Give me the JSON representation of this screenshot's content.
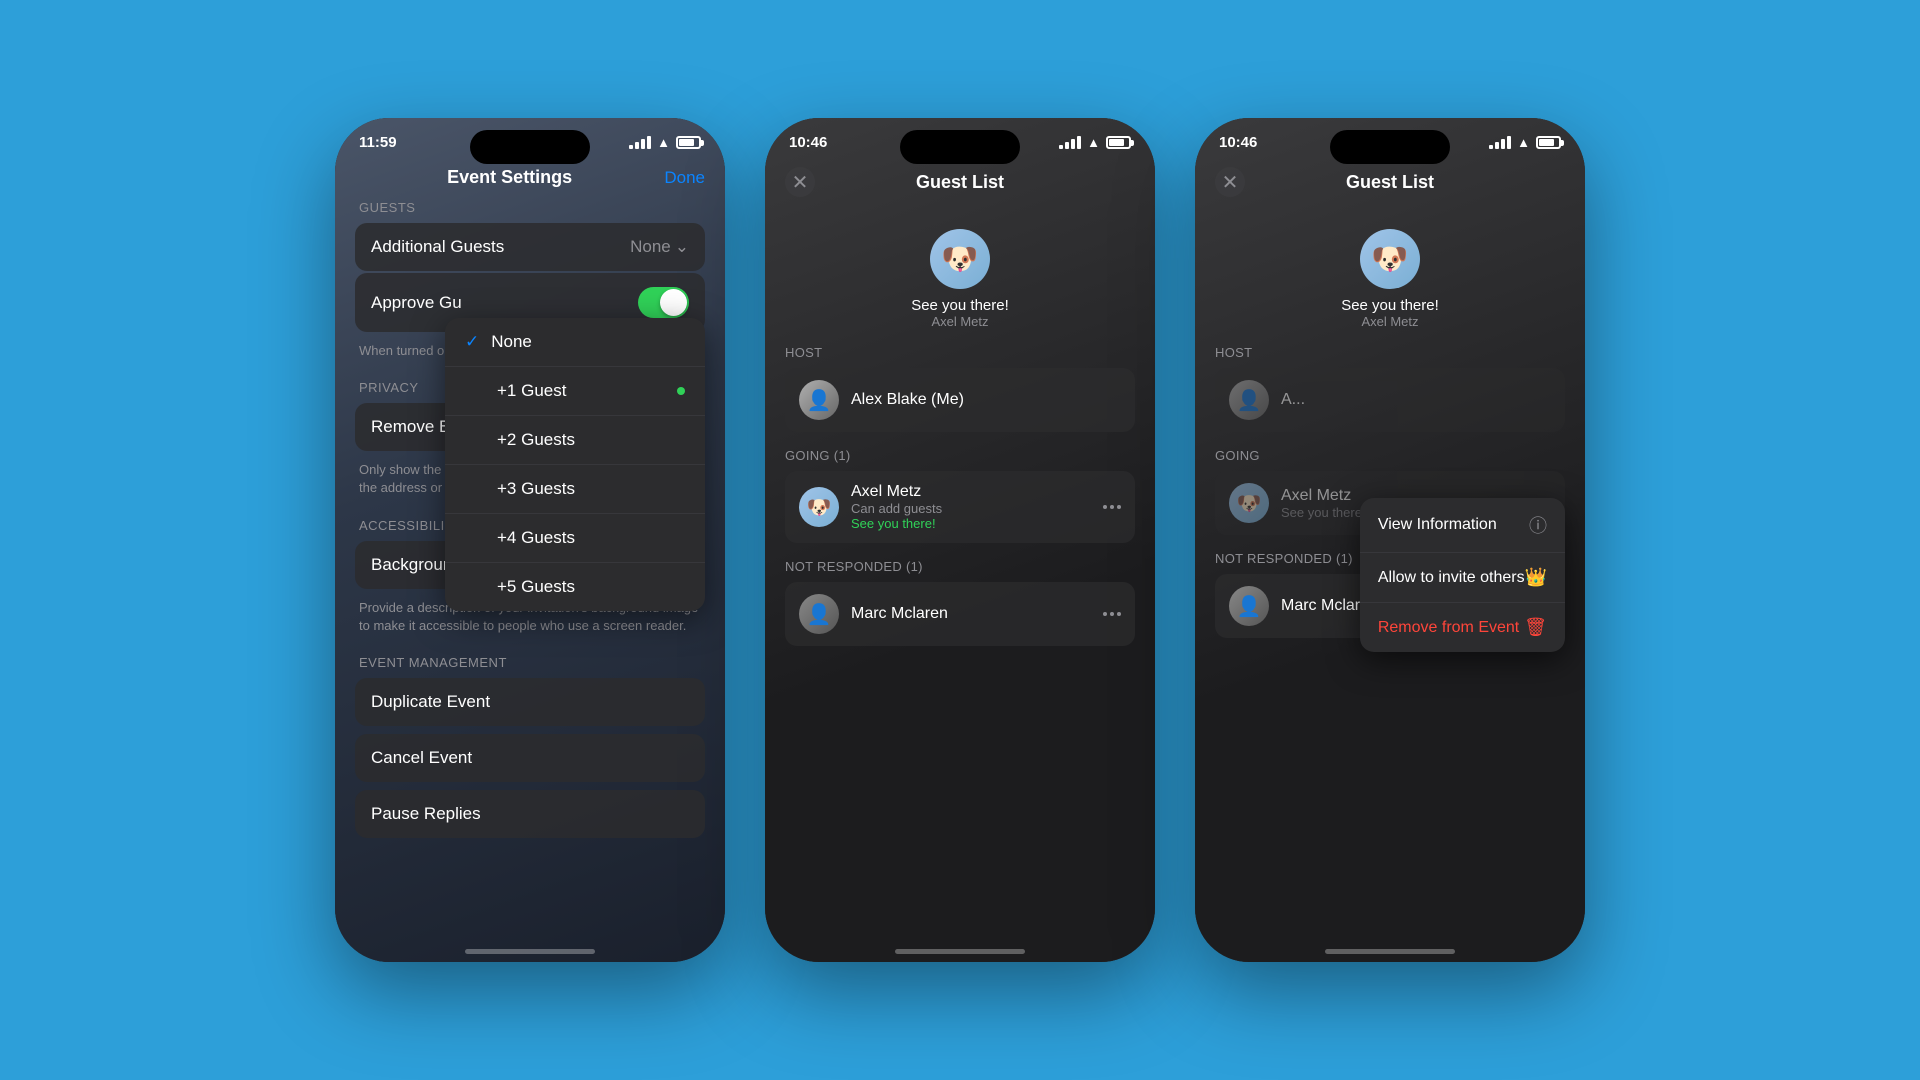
{
  "background": "#2d9fd9",
  "phone1": {
    "time": "11:59",
    "title": "Event Settings",
    "done_label": "Done",
    "sections": {
      "guests_label": "GUESTS",
      "additional_guests_label": "Additional Guests",
      "additional_guests_value": "None",
      "approve_guests_label": "Approve Gu",
      "approve_toggle": true,
      "approve_sub": "When turned on, they can join the event.",
      "privacy_label": "PRIVACY",
      "remove_background_label": "Remove Ba",
      "remove_background_sub": "Only show the event title when they've opened it — hide the address or from.",
      "accessibility_label": "ACCESSIBILITY",
      "bg_image_label": "Background Image Description",
      "bg_image_sub": "Provide a description of your invitation's background image to make it accessible to people who use a screen reader.",
      "event_management_label": "EVENT MANAGEMENT",
      "duplicate_label": "Duplicate Event",
      "cancel_label": "Cancel Event",
      "pause_label": "Pause Replies"
    },
    "dropdown": {
      "items": [
        {
          "label": "None",
          "selected": true,
          "dot": false
        },
        {
          "label": "+1 Guest",
          "selected": false,
          "dot": true
        },
        {
          "label": "+2 Guests",
          "selected": false,
          "dot": false
        },
        {
          "label": "+3 Guests",
          "selected": false,
          "dot": false
        },
        {
          "label": "+4 Guests",
          "selected": false,
          "dot": false
        },
        {
          "label": "+5 Guests",
          "selected": false,
          "dot": false
        }
      ]
    }
  },
  "phone2": {
    "time": "10:46",
    "title": "Guest List",
    "host_emoji": "🐶",
    "host_greeting": "See you there!",
    "host_name": "Axel Metz",
    "sections": {
      "host_label": "HOST",
      "host_person": "Alex Blake (Me)",
      "going_label": "GOING (1)",
      "going_guests": [
        {
          "name": "Axel Metz",
          "sub": "Can add guests",
          "sub2": "See you there!",
          "emoji": "🐶"
        }
      ],
      "not_responded_label": "NOT RESPONDED (1)",
      "not_responded_guests": [
        {
          "name": "Marc Mclaren",
          "sub": "",
          "emoji": "👤"
        }
      ]
    }
  },
  "phone3": {
    "time": "10:46",
    "title": "Guest List",
    "host_emoji": "🐶",
    "host_greeting": "See you there!",
    "host_name": "Axel Metz",
    "sections": {
      "host_label": "HOST",
      "going_label": "GOING",
      "going_guests": [
        {
          "name": "Axel Metz",
          "sub": "See you there!",
          "emoji": "🐶"
        }
      ],
      "not_responded_label": "NOT RESPONDED (1)",
      "not_responded_guests": [
        {
          "name": "Marc Mclaren",
          "sub": "",
          "emoji": "👤"
        }
      ]
    },
    "context_menu": {
      "items": [
        {
          "label": "View Information",
          "icon": "ⓘ",
          "red": false
        },
        {
          "label": "Allow to invite others",
          "icon": "👑",
          "red": false
        },
        {
          "label": "Remove from Event",
          "icon": "🗑",
          "red": true
        }
      ]
    }
  }
}
